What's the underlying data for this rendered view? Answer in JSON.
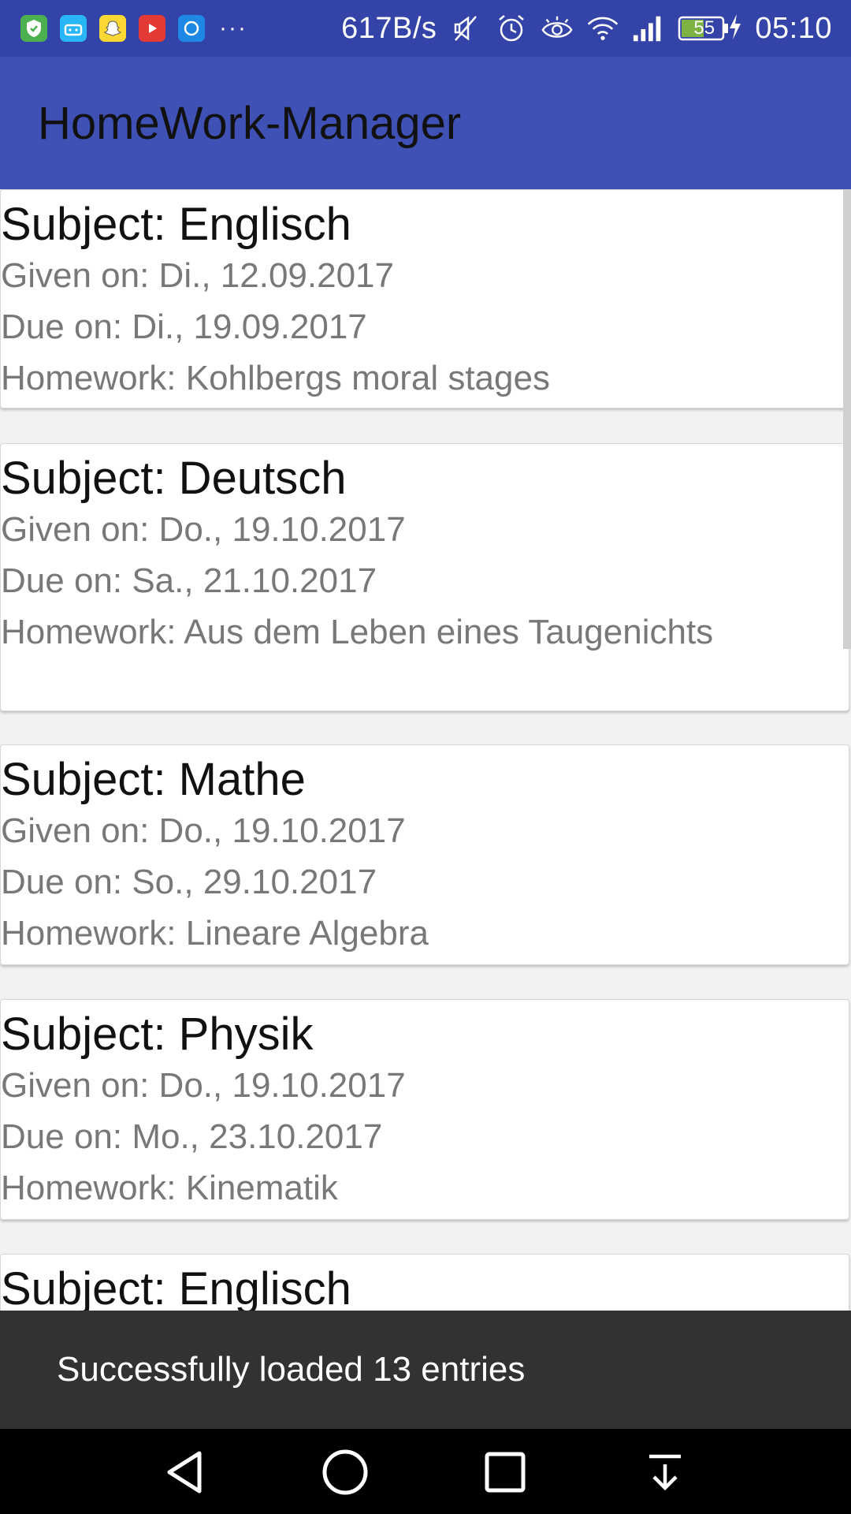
{
  "status_bar": {
    "app_icons": [
      {
        "name": "vpn-shield-icon",
        "color": "#4caf50",
        "glyph": "⛉"
      },
      {
        "name": "android-icon",
        "color": "#29b6f6",
        "glyph": "◔"
      },
      {
        "name": "snapchat-icon",
        "color": "#fdd835",
        "glyph": "☺"
      },
      {
        "name": "youtube-icon",
        "color": "#e53935",
        "glyph": "▶"
      },
      {
        "name": "circle-app-icon",
        "color": "#1e88e5",
        "glyph": "◯"
      }
    ],
    "more": "···",
    "network_speed": "617B/s",
    "battery_level": "55",
    "time": "05:10"
  },
  "app_bar": {
    "title": "HomeWork-Manager"
  },
  "entries": [
    {
      "subject": "Subject: Englisch",
      "given": "Given on: Di., 12.09.2017",
      "due": "Due on: Di., 19.09.2017",
      "homework": "Homework: Kohlbergs moral stages"
    },
    {
      "subject": "Subject: Deutsch",
      "given": "Given on: Do., 19.10.2017",
      "due": "Due on: Sa., 21.10.2017",
      "homework": "Homework: Aus dem Leben eines Taugenichts"
    },
    {
      "subject": "Subject: Mathe",
      "given": "Given on: Do., 19.10.2017",
      "due": "Due on: So., 29.10.2017",
      "homework": "Homework: Lineare Algebra"
    },
    {
      "subject": "Subject: Physik",
      "given": "Given on: Do., 19.10.2017",
      "due": "Due on: Mo., 23.10.2017",
      "homework": "Homework: Kinematik"
    },
    {
      "subject": "Subject: Englisch"
    }
  ],
  "snackbar": {
    "message": "Successfully loaded 13 entries"
  },
  "colors": {
    "status_bar": "#3343a7",
    "app_bar": "#3f51b5",
    "snackbar": "#323232",
    "nav_bar": "#000000"
  }
}
